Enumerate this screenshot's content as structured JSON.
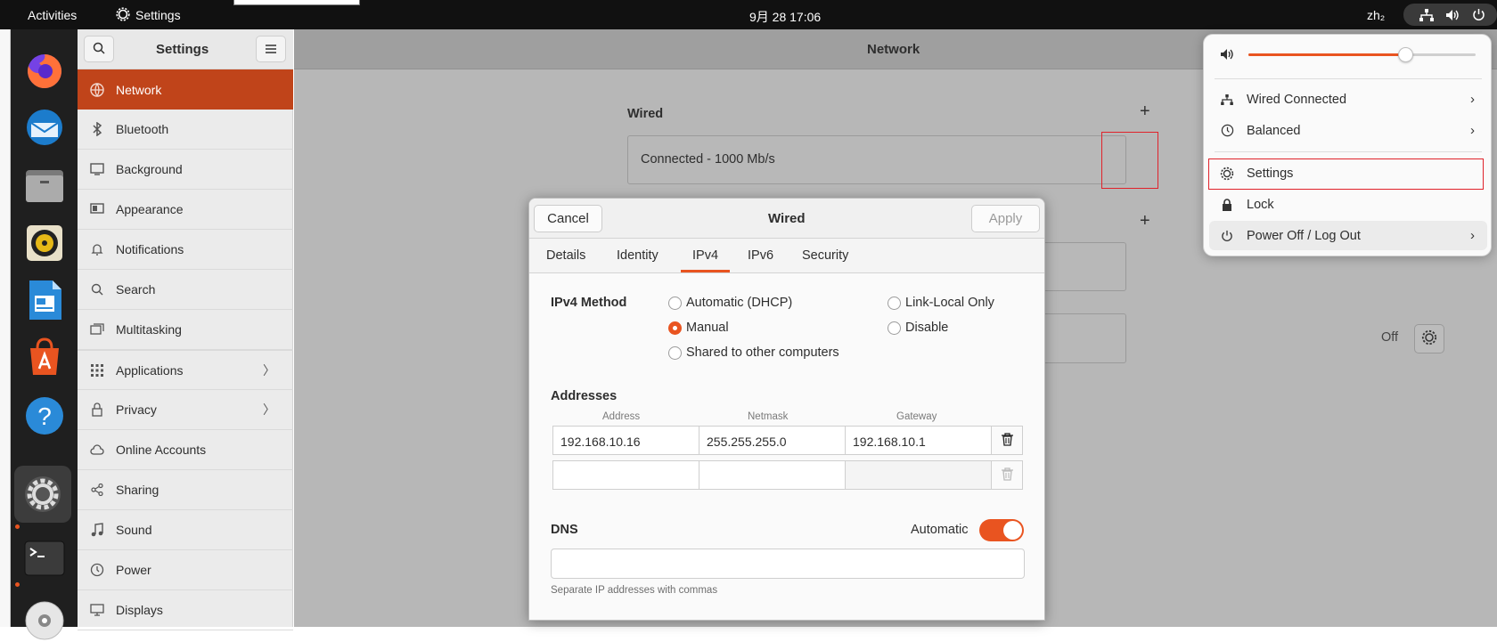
{
  "topbar": {
    "activities": "Activities",
    "app": "Settings",
    "clock": "9月 28  17:06",
    "input_method": "zh₂"
  },
  "sidebar": {
    "title": "Settings",
    "items": [
      {
        "label": "Network",
        "icon": "network-icon"
      },
      {
        "label": "Bluetooth",
        "icon": "bluetooth-icon"
      },
      {
        "label": "Background",
        "icon": "background-icon"
      },
      {
        "label": "Appearance",
        "icon": "appearance-icon"
      },
      {
        "label": "Notifications",
        "icon": "bell-icon"
      },
      {
        "label": "Search",
        "icon": "search-icon"
      },
      {
        "label": "Multitasking",
        "icon": "multitasking-icon"
      },
      {
        "label": "Applications",
        "icon": "grid-icon"
      },
      {
        "label": "Privacy",
        "icon": "lock-icon"
      },
      {
        "label": "Online Accounts",
        "icon": "cloud-icon"
      },
      {
        "label": "Sharing",
        "icon": "share-icon"
      },
      {
        "label": "Sound",
        "icon": "music-note-icon"
      },
      {
        "label": "Power",
        "icon": "power-icon"
      },
      {
        "label": "Displays",
        "icon": "display-icon"
      }
    ]
  },
  "main": {
    "title": "Network",
    "wired_section": "Wired",
    "wired_status": "Connected - 1000 Mb/s",
    "proxy_status": "Off"
  },
  "dialog": {
    "title": "Wired",
    "cancel": "Cancel",
    "apply": "Apply",
    "tabs": [
      "Details",
      "Identity",
      "IPv4",
      "IPv6",
      "Security"
    ],
    "active_tab": "IPv4",
    "ipv4_method_label": "IPv4 Method",
    "methods": {
      "automatic": "Automatic (DHCP)",
      "link_local": "Link-Local Only",
      "manual": "Manual",
      "disable": "Disable",
      "shared": "Shared to other computers"
    },
    "selected_method": "Manual",
    "addresses_label": "Addresses",
    "columns": {
      "address": "Address",
      "netmask": "Netmask",
      "gateway": "Gateway"
    },
    "rows": [
      {
        "address": "192.168.10.16",
        "netmask": "255.255.255.0",
        "gateway": "192.168.10.1"
      },
      {
        "address": "",
        "netmask": "",
        "gateway": ""
      }
    ],
    "dns_label": "DNS",
    "dns_automatic_label": "Automatic",
    "dns_automatic": true,
    "dns_value": "",
    "dns_hint": "Separate IP addresses with commas"
  },
  "quick_menu": {
    "volume": 0.69,
    "items": {
      "wired": "Wired Connected",
      "power_mode": "Balanced",
      "settings": "Settings",
      "lock": "Lock",
      "power": "Power Off / Log Out"
    }
  },
  "colors": {
    "accent": "#e95420",
    "selected_sidebar": "#c0441a",
    "highlight_box": "#e0222a"
  }
}
